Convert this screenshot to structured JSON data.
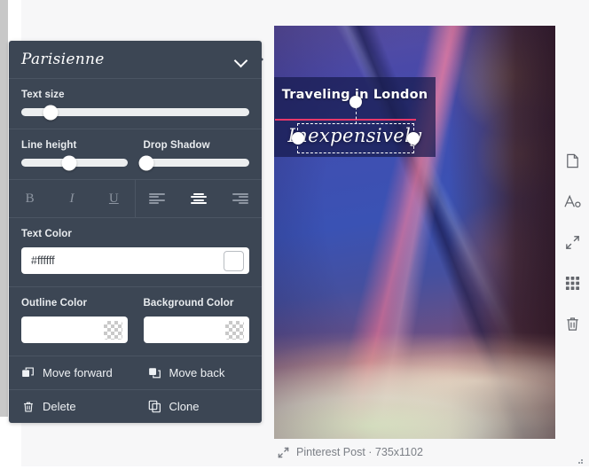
{
  "panel": {
    "font_name": "Parisienne",
    "collapse_icon": "chevron-down-icon",
    "text_size": {
      "label": "Text size",
      "value": 13
    },
    "line_height": {
      "label": "Line height",
      "value": 45
    },
    "drop_shadow": {
      "label": "Drop Shadow",
      "value": 3
    },
    "format": {
      "bold_label": "B",
      "italic_label": "I",
      "underline_label": "U",
      "align_left": "align-left-icon",
      "align_center": "align-center-icon",
      "align_right": "align-right-icon",
      "active_alignment": "center"
    },
    "text_color": {
      "label": "Text Color",
      "value": "#ffffff",
      "swatch": "#ffffff"
    },
    "outline_color": {
      "label": "Outline Color",
      "value": "",
      "swatch": "transparent"
    },
    "background_color": {
      "label": "Background Color",
      "value": "",
      "swatch": "transparent"
    },
    "actions": {
      "move_forward": "Move forward",
      "move_back": "Move back",
      "delete": "Delete",
      "clone": "Clone"
    }
  },
  "canvas": {
    "headline": "Traveling in London",
    "script_text": "Inexpensively",
    "divider_color": "#e8386a",
    "overlay_color": "#161a4c"
  },
  "tool_rail": {
    "items": [
      {
        "name": "page-icon"
      },
      {
        "name": "text-icon"
      },
      {
        "name": "resize-icon"
      },
      {
        "name": "grid-icon"
      },
      {
        "name": "trash-icon"
      }
    ]
  },
  "footer": {
    "resize_icon": "resize-icon",
    "caption": "Pinterest Post · 735x1102"
  }
}
